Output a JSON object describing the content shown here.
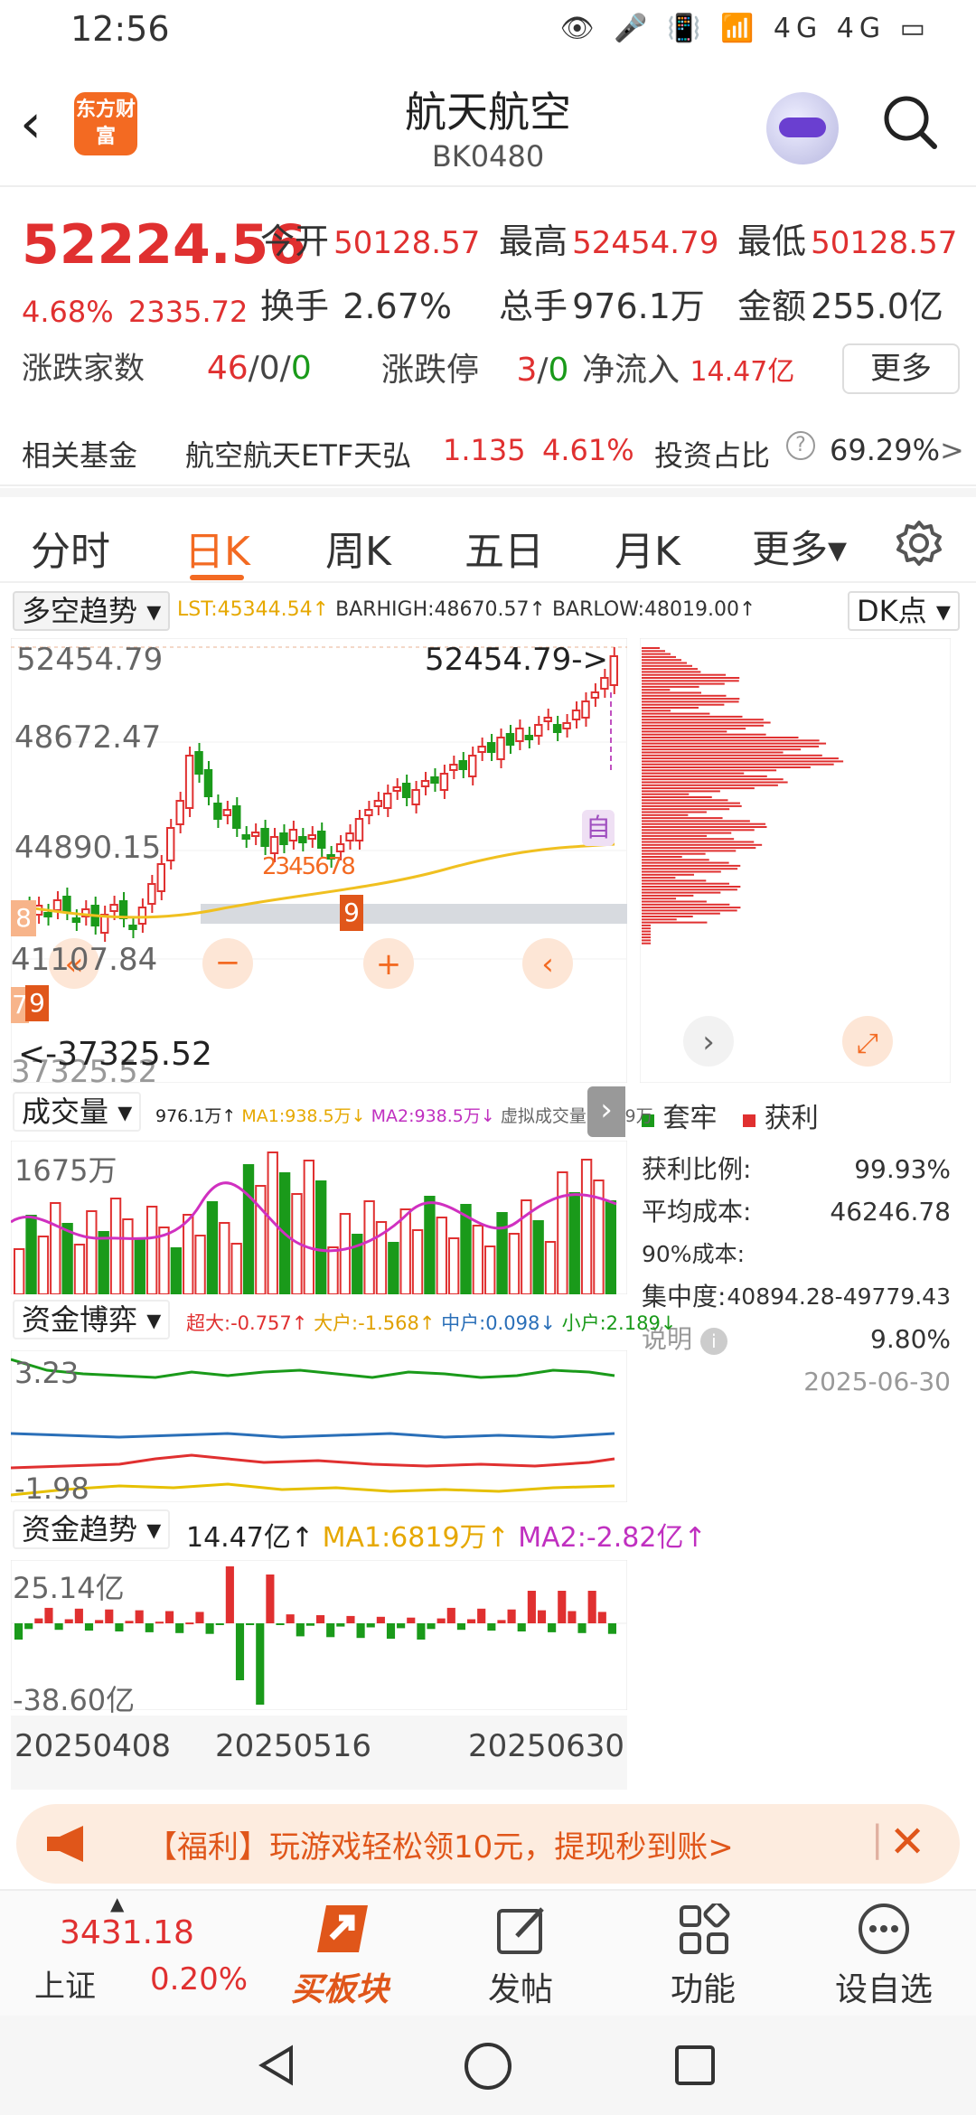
{
  "status_bar": {
    "time": "12:56",
    "icons": "👁 🎤 📳 📶 4G 4G ▭"
  },
  "header": {
    "logo_text": "东方财富",
    "title": "航天航空",
    "code": "BK0480"
  },
  "quote": {
    "price": "52224.56",
    "change_pct": "4.68%",
    "change_abs": "2335.72",
    "open_label": "今开",
    "open": "50128.57",
    "high_label": "最高",
    "high": "52454.79",
    "low_label": "最低",
    "low": "50128.57",
    "turnover_label": "换手",
    "turnover": "2.67%",
    "volume_label": "总手",
    "volume": "976.1万",
    "amount_label": "金额",
    "amount": "255.0亿",
    "updown_label": "涨跌家数",
    "up": "46",
    "flat": "0",
    "down": "0",
    "limit_label": "涨跌停",
    "limit_up": "3",
    "limit_down": "0",
    "inflow_label": "净流入",
    "inflow": "14.47亿",
    "more_label": "更多"
  },
  "fund": {
    "label": "相关基金",
    "name": "航空航天ETF天弘",
    "price": "1.135",
    "pct": "4.61%",
    "ratio_label": "投资占比",
    "ratio": "69.29%",
    "arrow": ">"
  },
  "tabs": [
    {
      "label": "分时"
    },
    {
      "label": "日K"
    },
    {
      "label": "周K"
    },
    {
      "label": "五日"
    },
    {
      "label": "月K"
    },
    {
      "label": "更多▾"
    }
  ],
  "kchart": {
    "indicator": "多空趋势",
    "lst": "LST:45344.54↑",
    "barhigh": "BARHIGH:48670.57↑",
    "barlow": "BARLOW:48019.00↑",
    "dk": "DK点",
    "y_labels": [
      "52454.79",
      "48672.47",
      "44890.15",
      "41107.84",
      "37325.52"
    ],
    "max_marker": "52454.79->",
    "min_marker": "<-37325.52",
    "self_tag": "自",
    "seq_labels": [
      "2",
      "3",
      "4",
      "5",
      "6",
      "7",
      "8",
      "9"
    ],
    "left_tag_8": "8",
    "left_tag_7": "7",
    "left_tag_9": "9",
    "tag_9": "9"
  },
  "volume": {
    "indicator": "成交量",
    "legend": "976.1万↑",
    "ma1": "MA1:938.5万↓",
    "ma2": "MA2:938.5万↓",
    "virtual": "虚拟成交量:1279万",
    "y_label": "1675万"
  },
  "capital_game": {
    "indicator": "资金博弈",
    "super": "超大:-0.757↑",
    "big": "大户:-1.568↑",
    "mid": "中户:0.098↓",
    "small": "小户:2.189↓",
    "y_top": "3.23",
    "y_bottom": "-1.98"
  },
  "capital_trend": {
    "indicator": "资金趋势",
    "value": "14.47亿↑",
    "ma1": "MA1:6819万↑",
    "ma2": "MA2:-2.82亿↑",
    "y_top": "25.14亿",
    "y_bottom": "-38.60亿"
  },
  "dates": [
    "20250408",
    "20250516",
    "20250630"
  ],
  "chip": {
    "legend_trapped": "套牢",
    "legend_profit": "获利",
    "rows": [
      {
        "label": "获利比例:",
        "value": "99.93%"
      },
      {
        "label": "平均成本:",
        "value": "46246.78"
      },
      {
        "label": "90%成本:",
        "value": "40894.28-49779.43"
      },
      {
        "label": "集中度:",
        "value": "9.80%"
      }
    ],
    "note_label": "说明",
    "date": "2025-06-30"
  },
  "banner": {
    "text": "【福利】玩游戏轻松领10元，提现秒到账>"
  },
  "bottom_nav": {
    "index_value": "3431.18",
    "index_name": "上证",
    "index_pct": "0.20%",
    "items": [
      {
        "label": "买板块"
      },
      {
        "label": "发帖"
      },
      {
        "label": "功能"
      },
      {
        "label": "设自选"
      }
    ]
  },
  "colors": {
    "accent": "#f36a22",
    "up": "#e03030",
    "down": "#1a9a1a"
  }
}
